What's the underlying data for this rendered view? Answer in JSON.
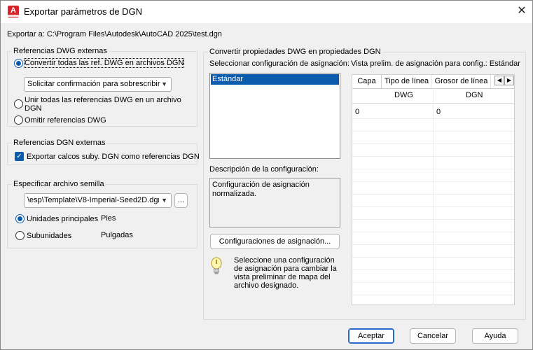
{
  "window": {
    "title": "Exportar parámetros de DGN",
    "close_glyph": "✕"
  },
  "export_path": "Exportar a: C:\\Program Files\\Autodesk\\AutoCAD 2025\\test.dgn",
  "dwg_refs": {
    "title": "Referencias DWG externas",
    "opt_convert": "Convertir todas las ref. DWG en archivos DGN",
    "overwrite_combo": "Solicitar confirmación para sobrescribir",
    "opt_merge": "Unir todas las referencias DWG en un archivo DGN",
    "opt_ignore": "Omitir referencias DWG"
  },
  "dgn_refs": {
    "title": "Referencias DGN externas",
    "check_export": "Exportar calcos suby. DGN como referencias DGN"
  },
  "seed": {
    "title": "Especificar archivo semilla",
    "file_combo": "\\esp\\Template\\V8-Imperial-Seed2D.dgn",
    "browse_label": "...",
    "opt_master": "Unidades principales",
    "master_value": "Pies",
    "opt_sub": "Subunidades",
    "sub_value": "Pulgadas"
  },
  "convert": {
    "title": "Convertir propiedades DWG en propiedades DGN",
    "select_label": "Seleccionar configuración de asignación:",
    "configs": [
      "Estándar"
    ],
    "desc_label": "Descripción de la configuración:",
    "description": "Configuración de asignación normalizada.",
    "configs_button": "Configuraciones de asignación...",
    "hint": "Seleccione una configuración de asignación para cambiar la vista preliminar de mapa del archivo designado.",
    "preview_label": "Vista prelim. de asignación para config.: Estándar",
    "tabs": [
      "Capa",
      "Tipo de línea",
      "Grosor de línea"
    ],
    "col_dwg": "DWG",
    "col_dgn": "DGN",
    "rows": [
      {
        "dwg": "0",
        "dgn": "0"
      }
    ]
  },
  "buttons": {
    "ok": "Aceptar",
    "cancel": "Cancelar",
    "help": "Ayuda"
  },
  "colors": {
    "accent": "#0b5cad",
    "app_icon": "#d8232a"
  }
}
